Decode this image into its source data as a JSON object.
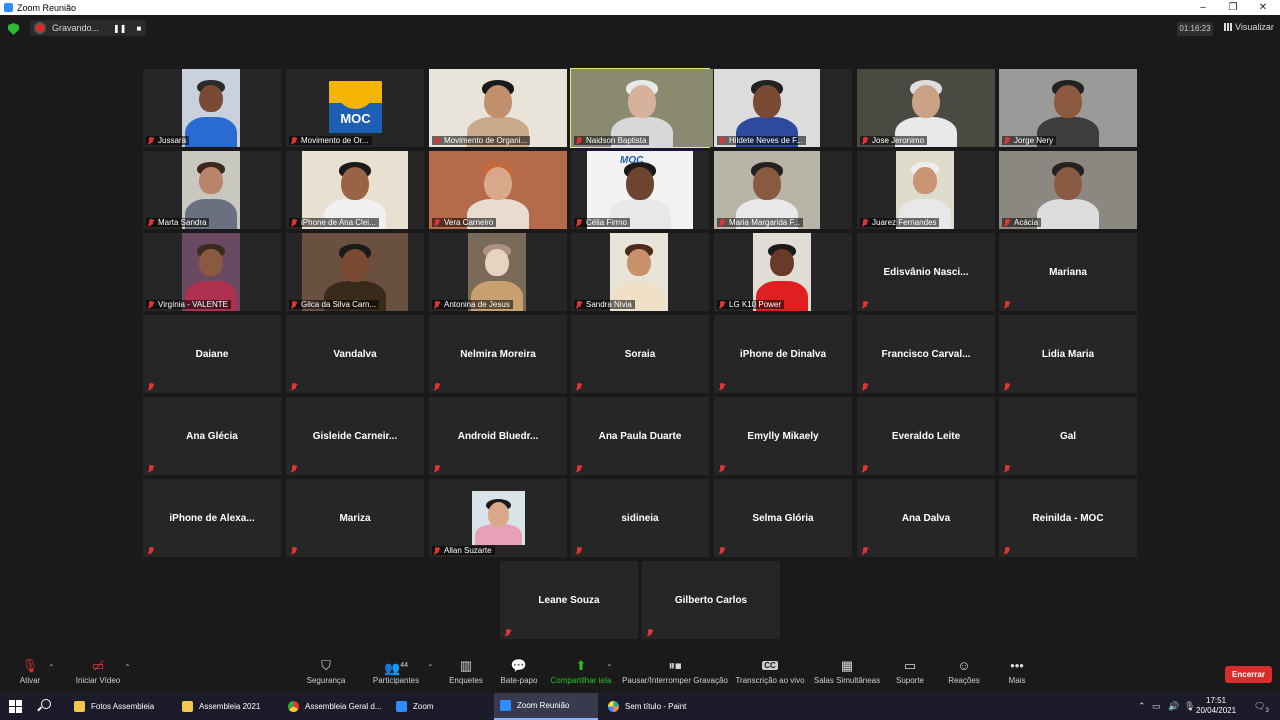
{
  "window": {
    "title": "Zoom Reunião",
    "minimize": "–",
    "maximize": "❐",
    "close": "✕"
  },
  "topbar": {
    "recording_label": "Gravando...",
    "pause_icon": "❚❚",
    "stop_icon": "■",
    "timer": "01:16:23",
    "view_label": "Visualizar"
  },
  "participants": [
    "Jussara",
    "Movimento de Or...",
    "Movimento de Organi...",
    "Naidson Baptista",
    "Hildete Neves de F...",
    "Jose Jeronimo",
    "Jorge Nery",
    "Marta Sandra",
    "iPhone de Ana Clei...",
    "Vera Carneiro",
    "Célia Firmo",
    "Maria Margarida F...",
    "Juarez Fernandes",
    "Acácia",
    "Virgínia - VALENTE",
    "Gilca da Silva Carn...",
    "Antonina de Jesus",
    "Sandra Nivia",
    "LG K10 Power",
    "Edisvânio  Nasci...",
    "Mariana",
    "Daiane",
    "Vandalva",
    "Nelmira Moreira",
    "Soraia",
    "iPhone de Dinalva",
    "Francisco  Carval...",
    "Lidia Maria",
    "Ana Glécia",
    "Gisleide  Carneir...",
    "Android  Bluedr...",
    "Ana Paula Duarte",
    "Emylly Mikaely",
    "Everaldo Leite",
    "Gal",
    "iPhone  de  Alexa...",
    "Mariza",
    "Allan Suzarte",
    "sidineia",
    "Selma Glória",
    "Ana Dalva",
    "Reinilda - MOC",
    "Leane Souza",
    "Gilberto Carlos"
  ],
  "moc_logo_text": "MOC",
  "toolbar": {
    "mute": "Ativar",
    "video": "Iniciar Vídeo",
    "security": "Segurança",
    "participants": "Participantes",
    "participants_count": "44",
    "polls": "Enquetes",
    "chat": "Bate-papo",
    "share": "Compartilhar tela",
    "pause_record": "Pausar/Interromper Gravação",
    "transcription": "Transcrição ao vivo",
    "breakout": "Salas Simultâneas",
    "support": "Suporte",
    "reactions": "Reações",
    "more": "Mais",
    "end": "Encerrar",
    "cc_badge": "CC"
  },
  "taskbar": {
    "items": [
      "Fotos Assembleia",
      "Assembleia 2021",
      "Assembleia Geral d...",
      "Zoom",
      "Zoom Reunião",
      "Sem título - Paint"
    ],
    "time": "17:51",
    "date": "20/04/2021",
    "notifications": "3"
  },
  "colors": {
    "accent_green": "#27c227",
    "end_red": "#d92d2d",
    "speaker_border": "#e5e87a",
    "muted_red": "#e03434"
  }
}
